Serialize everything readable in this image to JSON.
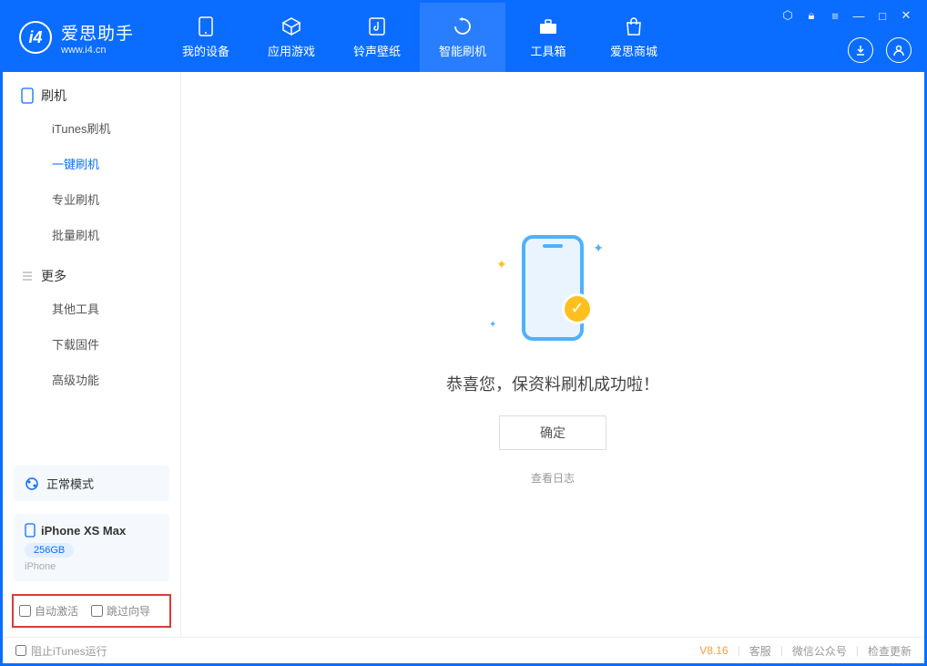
{
  "app": {
    "name_cn": "爱思助手",
    "url": "www.i4.cn"
  },
  "nav": {
    "items": [
      {
        "label": "我的设备"
      },
      {
        "label": "应用游戏"
      },
      {
        "label": "铃声壁纸"
      },
      {
        "label": "智能刷机"
      },
      {
        "label": "工具箱"
      },
      {
        "label": "爱思商城"
      }
    ],
    "active_index": 3
  },
  "sidebar": {
    "section1": {
      "title": "刷机",
      "items": [
        "iTunes刷机",
        "一键刷机",
        "专业刷机",
        "批量刷机"
      ],
      "active_index": 1
    },
    "section2": {
      "title": "更多",
      "items": [
        "其他工具",
        "下载固件",
        "高级功能"
      ]
    },
    "mode": "正常模式",
    "device": {
      "name": "iPhone XS Max",
      "capacity": "256GB",
      "type": "iPhone"
    },
    "options": {
      "auto_activate": "自动激活",
      "skip_guide": "跳过向导"
    }
  },
  "main": {
    "success_msg": "恭喜您，保资料刷机成功啦！",
    "ok": "确定",
    "view_log": "查看日志"
  },
  "footer": {
    "block_itunes": "阻止iTunes运行",
    "version": "V8.16",
    "links": [
      "客服",
      "微信公众号",
      "检查更新"
    ]
  }
}
